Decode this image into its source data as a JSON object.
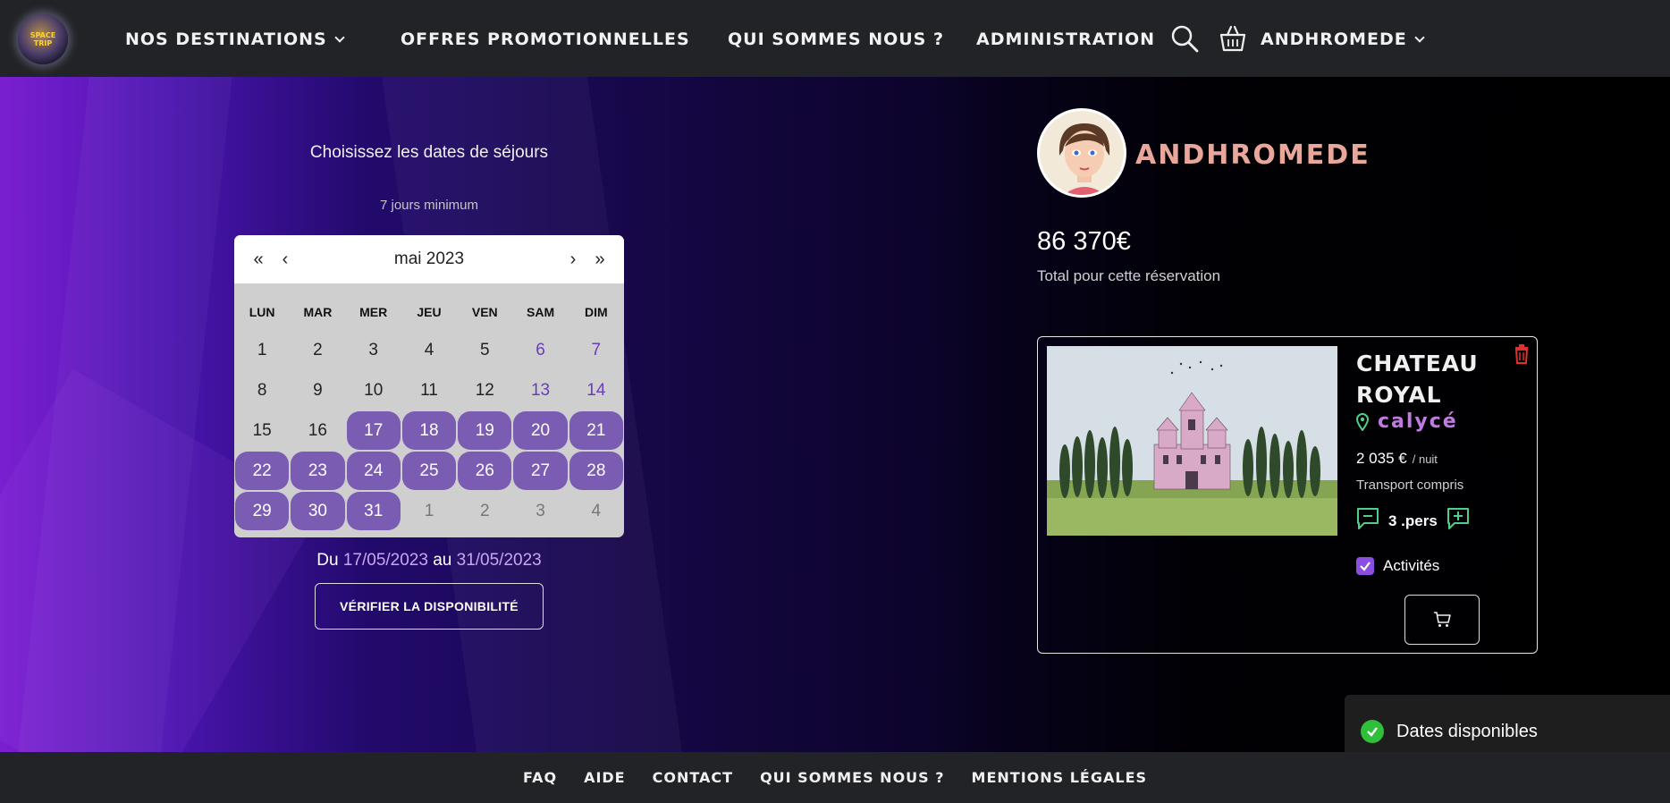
{
  "nav": {
    "logo_text": "SPACE TRIP",
    "destinations": "NOS DESTINATIONS",
    "promotions": "OFFRES PROMOTIONNELLES",
    "about": "QUI SOMMES NOUS ?",
    "admin": "ADMINISTRATION",
    "user": "ANDHROMEDE"
  },
  "calendar": {
    "title": "Choisissez les dates de séjours",
    "subtitle": "7 jours minimum",
    "first": "«",
    "prev": "‹",
    "month": "mai 2023",
    "next": "›",
    "last": "»",
    "weekdays": [
      "LUN",
      "MAR",
      "MER",
      "JEU",
      "VEN",
      "SAM",
      "DIM"
    ],
    "days": [
      {
        "label": "1",
        "kind": "normal"
      },
      {
        "label": "2",
        "kind": "normal"
      },
      {
        "label": "3",
        "kind": "normal"
      },
      {
        "label": "4",
        "kind": "normal"
      },
      {
        "label": "5",
        "kind": "normal"
      },
      {
        "label": "6",
        "kind": "weekend"
      },
      {
        "label": "7",
        "kind": "weekend"
      },
      {
        "label": "8",
        "kind": "normal"
      },
      {
        "label": "9",
        "kind": "normal"
      },
      {
        "label": "10",
        "kind": "normal"
      },
      {
        "label": "11",
        "kind": "normal"
      },
      {
        "label": "12",
        "kind": "normal"
      },
      {
        "label": "13",
        "kind": "weekend"
      },
      {
        "label": "14",
        "kind": "weekend"
      },
      {
        "label": "15",
        "kind": "normal"
      },
      {
        "label": "16",
        "kind": "normal"
      },
      {
        "label": "17",
        "kind": "selected"
      },
      {
        "label": "18",
        "kind": "selected"
      },
      {
        "label": "19",
        "kind": "selected"
      },
      {
        "label": "20",
        "kind": "selected"
      },
      {
        "label": "21",
        "kind": "selected"
      },
      {
        "label": "22",
        "kind": "selected"
      },
      {
        "label": "23",
        "kind": "selected"
      },
      {
        "label": "24",
        "kind": "selected"
      },
      {
        "label": "25",
        "kind": "selected"
      },
      {
        "label": "26",
        "kind": "selected"
      },
      {
        "label": "27",
        "kind": "selected"
      },
      {
        "label": "28",
        "kind": "selected"
      },
      {
        "label": "29",
        "kind": "selected"
      },
      {
        "label": "30",
        "kind": "selected"
      },
      {
        "label": "31",
        "kind": "selected"
      },
      {
        "label": "1",
        "kind": "other"
      },
      {
        "label": "2",
        "kind": "other"
      },
      {
        "label": "3",
        "kind": "other"
      },
      {
        "label": "4",
        "kind": "other"
      }
    ],
    "range_prefix": "Du",
    "range_start": "17/05/2023",
    "range_mid": "au",
    "range_end": "31/05/2023",
    "check_button": "VÉRIFIER LA DISPONIBILITÉ"
  },
  "profile": {
    "username": "ANDHROMEDE",
    "total": "86 370€",
    "total_label": "Total pour cette réservation"
  },
  "booking": {
    "title_line1": "CHATEAU",
    "title_line2": "ROYAL",
    "location": "calycé",
    "price": "2 035 €",
    "price_unit": "/ nuit",
    "transport": "Transport compris",
    "persons": "3 .pers",
    "activities": "Activités"
  },
  "toast": {
    "text": "Dates disponibles"
  },
  "footer": {
    "links": [
      "FAQ",
      "AIDE",
      "CONTACT",
      "QUI SOMMES NOUS ?",
      "MENTIONS LÉGALES"
    ]
  },
  "colors": {
    "accent": "#7b5cb3",
    "username": "#e8a79a",
    "location": "#c07be0",
    "success": "#2fbf3a",
    "delete": "#e0302a"
  }
}
